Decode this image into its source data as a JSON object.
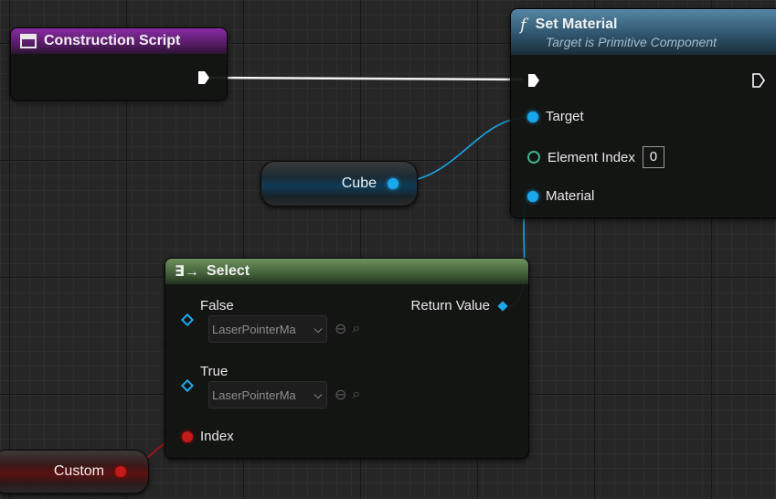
{
  "nodes": {
    "construction_script": {
      "title": "Construction Script"
    },
    "set_material": {
      "title": "Set Material",
      "subtitle": "Target is Primitive Component",
      "function_symbol": "f",
      "pins": {
        "target": "Target",
        "element_index": "Element Index",
        "element_index_value": "0",
        "material": "Material"
      }
    },
    "cube_variable": {
      "label": "Cube"
    },
    "select": {
      "title": "Select",
      "pins": {
        "false_label": "False",
        "false_value": "LaserPointerMa",
        "true_label": "True",
        "true_value": "LaserPointerMa",
        "index_label": "Index",
        "return_value": "Return Value"
      }
    },
    "custom_variable": {
      "label": "Custom"
    }
  },
  "colors": {
    "construction_header": "#8a2aa6",
    "set_material_header": "#3d6f8e",
    "select_header": "#5f8050",
    "object_pin": "#1aa7ec",
    "integer_pin": "#3fb08a",
    "byte_pin": "#c41a1a",
    "exec_pin": "#ffffff"
  },
  "icons": {
    "construction_script": "blueprint-function-icon",
    "select": "select-arrow-icon",
    "asset_actions": [
      "use-selected-icon",
      "browse-icon"
    ]
  }
}
